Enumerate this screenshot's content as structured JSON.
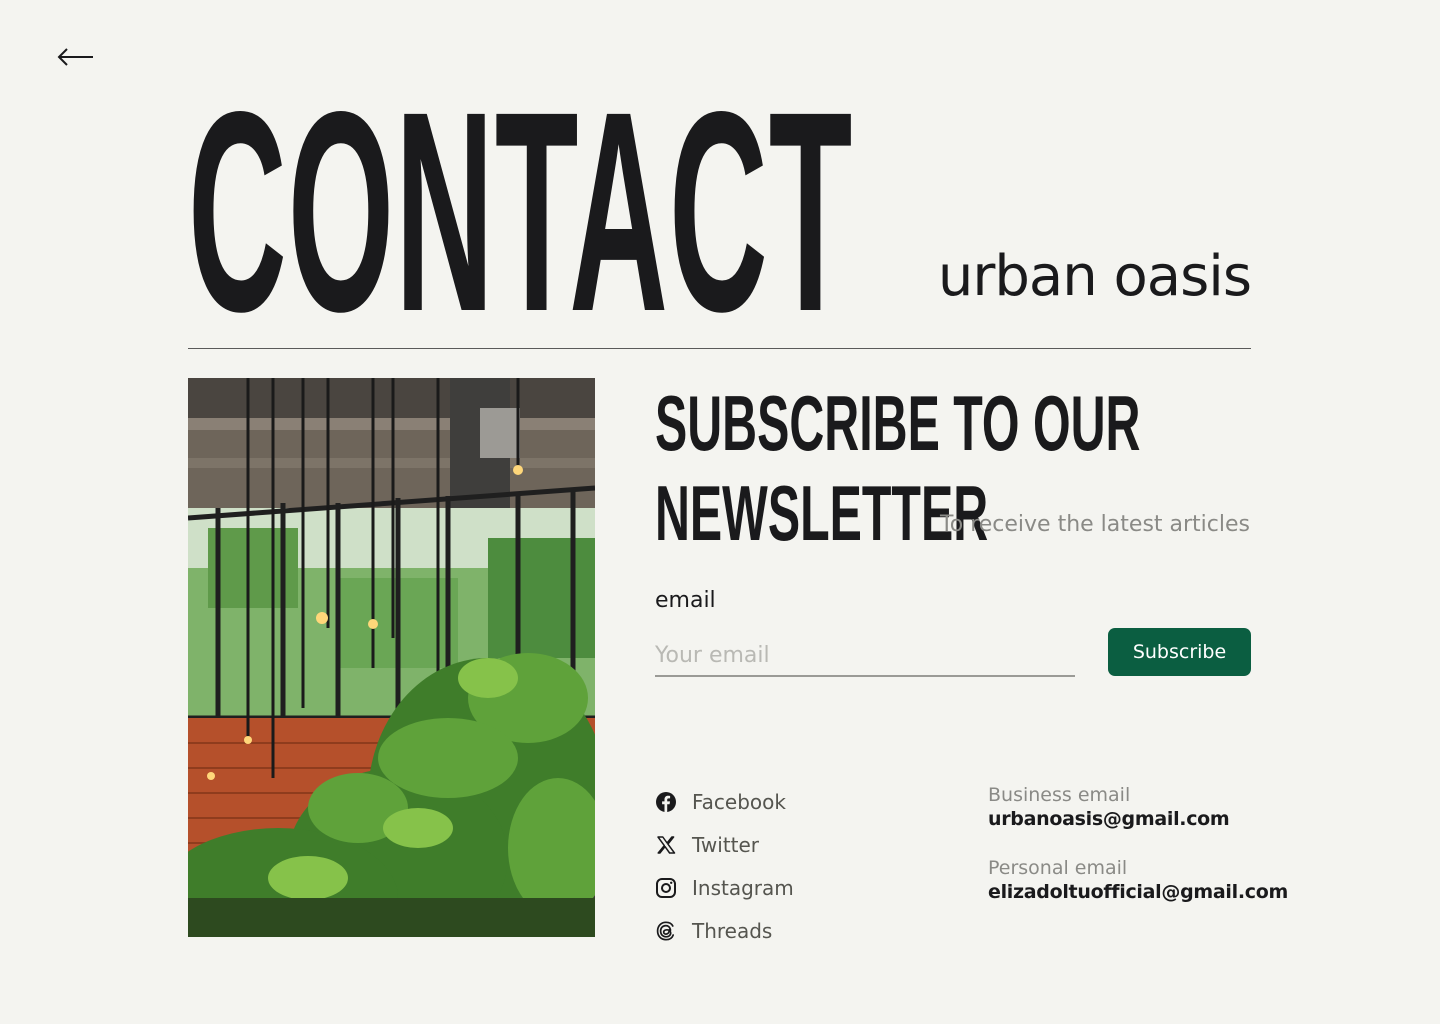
{
  "nav": {
    "back_icon": "arrow-left-icon"
  },
  "hero": {
    "title": "CONTACT",
    "subtitle": "urban oasis"
  },
  "newsletter": {
    "heading_line1": "SUBSCRIBE TO OUR",
    "heading_line2": "NEWSLETTER",
    "tagline": "To receive the latest articles",
    "email_label": "email",
    "email_placeholder": "Your email",
    "email_value": "",
    "subscribe_label": "Subscribe",
    "accent_color": "#0b5e41"
  },
  "socials": [
    {
      "label": "Facebook",
      "icon": "facebook-icon"
    },
    {
      "label": "Twitter",
      "icon": "x-twitter-icon"
    },
    {
      "label": "Instagram",
      "icon": "instagram-icon"
    },
    {
      "label": "Threads",
      "icon": "threads-icon"
    }
  ],
  "contacts": {
    "business_label": "Business email",
    "business_value": "urbanoasis@gmail.com",
    "personal_label": "Personal email",
    "personal_value": "elizadoltuofficial@gmail.com"
  },
  "photo": {
    "icon": "plant-cafe-photo"
  }
}
